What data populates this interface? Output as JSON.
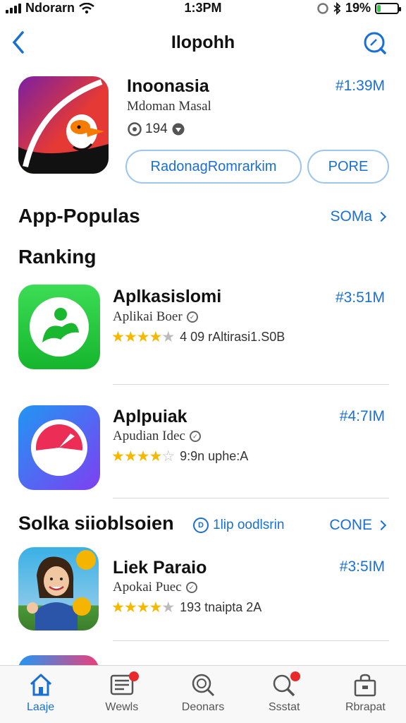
{
  "status_bar": {
    "carrier": "Ndorarn",
    "time": "1:3PM",
    "battery_percent": "19%",
    "battery_level": 0.19
  },
  "nav": {
    "title": "Ilopohh"
  },
  "featured": {
    "name": "Inoonasia",
    "developer": "Mdoman Masal",
    "meta": "194",
    "size": "#1:39M",
    "primary_button": "RadonagRomrarkim",
    "secondary_button": "PORE"
  },
  "sections": {
    "popular": {
      "title": "App-Populas",
      "see_all": "SOMa"
    },
    "ranking": {
      "title": "Ranking"
    },
    "second": {
      "title": "Solka siioblsoien",
      "mid_link": "1lip oodlsrin",
      "see_all": "CONE"
    }
  },
  "apps": [
    {
      "name": "Aplkasislomi",
      "developer": "Aplikai Boer",
      "rating": 4,
      "rating_text": "4 09 rAltirasi1.S0B",
      "size": "#3:51M"
    },
    {
      "name": "Aplpuiak",
      "developer": "Apudian Idec",
      "rating": 4,
      "rating_text": "9:9n uphe:A",
      "size": "#4:7IM"
    },
    {
      "name": "Liek Paraio",
      "developer": "Apokai Puec",
      "rating": 4,
      "rating_text": "193 tnaipta 2A",
      "size": "#3:5IM"
    }
  ],
  "tabs": [
    {
      "label": "Laaje",
      "icon": "home-icon",
      "active": true
    },
    {
      "label": "Wewls",
      "icon": "news-icon",
      "badge": true
    },
    {
      "label": "Deonars",
      "icon": "discover-icon"
    },
    {
      "label": "Ssstat",
      "icon": "search-icon",
      "badge": true
    },
    {
      "label": "Rbrapat",
      "icon": "bag-icon"
    }
  ],
  "colors": {
    "accent": "#1a6fd4",
    "star": "#f5b800",
    "badge": "#e8282b"
  }
}
